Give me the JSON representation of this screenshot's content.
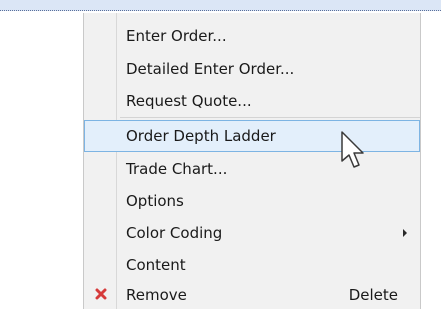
{
  "context_menu": {
    "items": [
      {
        "label": "Enter Order..."
      },
      {
        "label": "Detailed Enter Order..."
      },
      {
        "label": "Request Quote..."
      },
      {
        "label": "Order Depth Ladder"
      },
      {
        "label": "Trade Chart..."
      },
      {
        "label": "Options"
      },
      {
        "label": "Color Coding"
      },
      {
        "label": "Content"
      },
      {
        "label": "Remove",
        "shortcut": "Delete"
      }
    ],
    "highlighted_item": "Order Depth Ladder",
    "colors": {
      "menu_background": "#f1f1f1",
      "highlight_background": "#e3effb",
      "highlight_border": "#7db4e3",
      "remove_icon": "#d63b3b"
    }
  },
  "icons": {
    "remove": "close-icon",
    "submenu": "chevron-right-icon",
    "pointer": "mouse-pointer-icon"
  }
}
